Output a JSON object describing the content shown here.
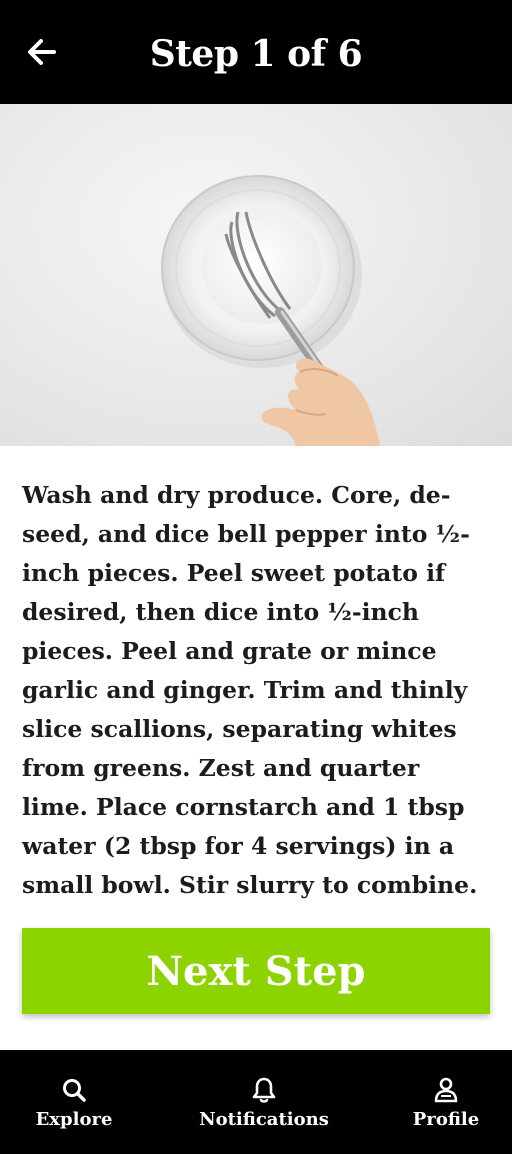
{
  "header": {
    "title": "Step 1 of 6",
    "back_icon": "arrow-left-icon"
  },
  "hero": {
    "image": "whisk-in-glass-bowl-photo"
  },
  "step": {
    "instructions": "Wash and dry produce. Core, de-seed, and dice bell pepper into ½-inch pieces. Peel sweet potato if desired, then dice into ½-inch pieces. Peel and grate or mince garlic and ginger. Trim and thinly slice scallions, separating whites from greens. Zest and quarter lime. Place cornstarch and 1 tbsp water (2 tbsp for 4 servings) in a small bowl. Stir slurry to combine."
  },
  "actions": {
    "next_label": "Next Step",
    "accent": "#8cd300"
  },
  "tabbar": {
    "items": [
      {
        "label": "Explore",
        "icon": "search-icon"
      },
      {
        "label": "Notifications",
        "icon": "bell-icon"
      },
      {
        "label": "Profile",
        "icon": "user-icon"
      }
    ]
  }
}
